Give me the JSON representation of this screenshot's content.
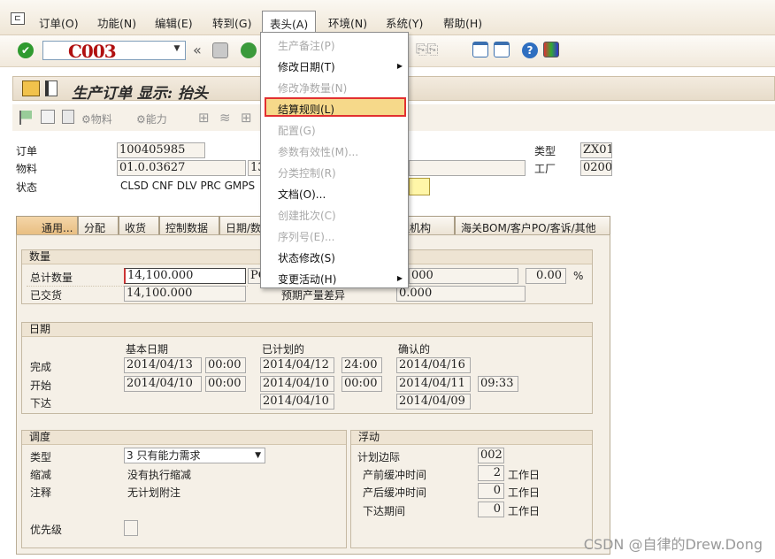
{
  "menu": {
    "items": [
      "订单(O)",
      "功能(N)",
      "编辑(E)",
      "转到(G)",
      "表头(A)",
      "环境(N)",
      "系统(Y)",
      "帮助(H)"
    ]
  },
  "command": {
    "value": "C003"
  },
  "title": "生产订单 显示: 抬头",
  "appbar": {
    "material": "物料",
    "capacity": "能力"
  },
  "header": {
    "order_label": "订单",
    "order_value": "100405985",
    "material_label": "物料",
    "material_value": "01.0.03627",
    "material_desc_prefix": "13",
    "status_label": "状态",
    "status_value": "CLSD CNF  DLV  PRC  GMPS",
    "type_label": "类型",
    "type_value": "ZX01",
    "plant_label": "工厂",
    "plant_value": "0200"
  },
  "tabs": [
    "通用...",
    "分配",
    "收货",
    "控制数据",
    "日期/数",
    "理机构",
    "海关BOM/客户PO/客诉/其他"
  ],
  "qty": {
    "group": "数量",
    "total_label": "总计数量",
    "total_value": "14,100.000",
    "total_unit_prefix": "PC",
    "delivered_label": "已交货",
    "delivered_value": "14,100.000",
    "scrap_value": "000",
    "scrap_pct": "0.00",
    "pct_sign": "%",
    "expected_dev_label": "预期产量差异",
    "expected_dev_value": "0.000"
  },
  "dates": {
    "group": "日期",
    "col_basic": "基本日期",
    "col_planned": "已计划的",
    "col_confirmed": "确认的",
    "finish_label": "完成",
    "finish_basic": "2014/04/13",
    "finish_basic_time": "00:00",
    "finish_planned": "2014/04/12",
    "finish_planned_time": "24:00",
    "finish_confirmed": "2014/04/16",
    "start_label": "开始",
    "start_basic": "2014/04/10",
    "start_basic_time": "00:00",
    "start_planned": "2014/04/10",
    "start_planned_time": "00:00",
    "start_confirmed": "2014/04/11",
    "start_confirmed_time": "09:33",
    "release_label": "下达",
    "release_planned": "2014/04/10",
    "release_confirmed": "2014/04/09"
  },
  "sched": {
    "group": "调度",
    "type_label": "类型",
    "type_value": "3 只有能力需求",
    "reduce_label": "缩减",
    "reduce_value": "没有执行缩减",
    "note_label": "注释",
    "note_value": "无计划附注",
    "priority_label": "优先级"
  },
  "float": {
    "group": "浮动",
    "margin_label": "计划边际",
    "margin_value": "002",
    "pre_label": "产前缓冲时间",
    "pre_value": "2",
    "post_label": "产后缓冲时间",
    "post_value": "0",
    "release_label": "下达期间",
    "release_value": "0",
    "unit": "工作日"
  },
  "dropdown": {
    "items": [
      {
        "label": "生产备注(P)",
        "enabled": false,
        "sub": false
      },
      {
        "label": "修改日期(T)",
        "enabled": true,
        "sub": true
      },
      {
        "label": "修改净数量(N)",
        "enabled": false,
        "sub": false
      },
      {
        "label": "结算规则(L)",
        "enabled": true,
        "sub": false
      },
      {
        "label": "配置(G)",
        "enabled": false,
        "sub": false
      },
      {
        "label": "参数有效性(M)...",
        "enabled": false,
        "sub": false
      },
      {
        "label": "分类控制(R)",
        "enabled": false,
        "sub": false
      },
      {
        "label": "文档(O)...",
        "enabled": true,
        "sub": false
      },
      {
        "label": "创建批次(C)",
        "enabled": false,
        "sub": false
      },
      {
        "label": "序列号(E)...",
        "enabled": false,
        "sub": false
      },
      {
        "label": "状态修改(S)",
        "enabled": true,
        "sub": false
      },
      {
        "label": "变更活动(H)",
        "enabled": true,
        "sub": true
      }
    ]
  },
  "watermark": "CSDN @自律的Drew.Dong",
  "colors": {
    "accent": "#e8bd80",
    "highlight": "#f6d98a",
    "highlight_border": "#e23030",
    "cmd_text": "#b01010"
  }
}
